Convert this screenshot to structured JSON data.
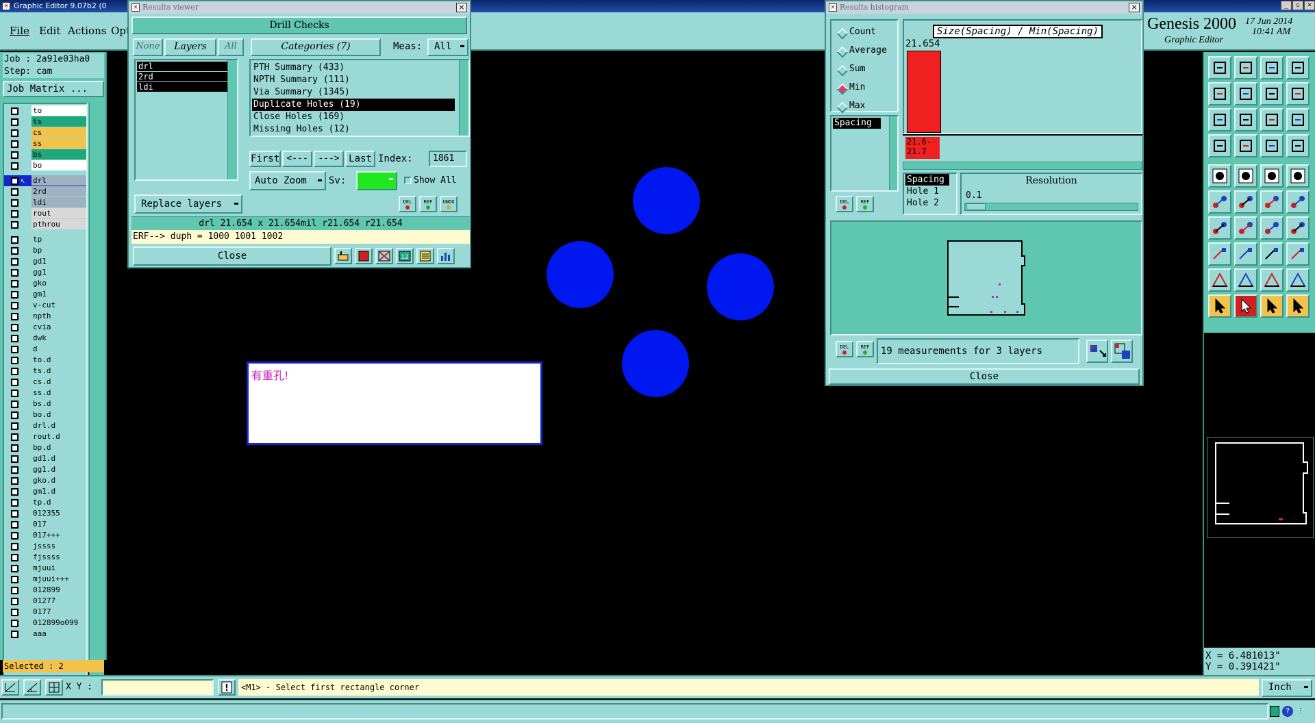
{
  "app": {
    "title": "Graphic Editor 9.07b2 (0",
    "brand": "Genesis 2000",
    "brand_sub": "Graphic Editor",
    "date": "17 Jun 2014",
    "time": "10:41 AM"
  },
  "menu": [
    "File",
    "Edit",
    "Actions",
    "Opt"
  ],
  "job": {
    "job_label": "Job : 2a91e03ha0",
    "step_label": "Step: cam",
    "matrix_button": "Job Matrix ..."
  },
  "layers": [
    {
      "name": "to",
      "color": "#ffffff"
    },
    {
      "name": "ts",
      "color": "#1fa67a"
    },
    {
      "name": "cs",
      "color": "#f3c24a"
    },
    {
      "name": "ss",
      "color": "#f3c24a"
    },
    {
      "name": "bs",
      "color": "#1fa67a"
    },
    {
      "name": "bo",
      "color": "#ffffff"
    },
    {
      "name": "drl",
      "color": "#9fb2c2",
      "active": true
    },
    {
      "name": "2rd",
      "color": "#9fb2c2"
    },
    {
      "name": "ldi",
      "color": "#9fb2c2"
    },
    {
      "name": "rout",
      "color": "#d8d8d8"
    },
    {
      "name": "pthrou",
      "color": "#d8d8d8"
    },
    {
      "name": "tp",
      "color": "#9ad9d6"
    },
    {
      "name": "bp",
      "color": "#9ad9d6"
    },
    {
      "name": "gd1",
      "color": "#9ad9d6"
    },
    {
      "name": "gg1",
      "color": "#9ad9d6"
    },
    {
      "name": "gko",
      "color": "#9ad9d6"
    },
    {
      "name": "gm1",
      "color": "#9ad9d6"
    },
    {
      "name": "v-cut",
      "color": "#9ad9d6"
    },
    {
      "name": "npth",
      "color": "#9ad9d6"
    },
    {
      "name": "cvia",
      "color": "#9ad9d6"
    },
    {
      "name": "dwk",
      "color": "#9ad9d6"
    },
    {
      "name": "d",
      "color": "#9ad9d6"
    },
    {
      "name": "to.d",
      "color": "#9ad9d6"
    },
    {
      "name": "ts.d",
      "color": "#9ad9d6"
    },
    {
      "name": "cs.d",
      "color": "#9ad9d6"
    },
    {
      "name": "ss.d",
      "color": "#9ad9d6"
    },
    {
      "name": "bs.d",
      "color": "#9ad9d6"
    },
    {
      "name": "bo.d",
      "color": "#9ad9d6"
    },
    {
      "name": "drl.d",
      "color": "#9ad9d6"
    },
    {
      "name": "rout.d",
      "color": "#9ad9d6"
    },
    {
      "name": "bp.d",
      "color": "#9ad9d6"
    },
    {
      "name": "gd1.d",
      "color": "#9ad9d6"
    },
    {
      "name": "gg1.d",
      "color": "#9ad9d6"
    },
    {
      "name": "gko.d",
      "color": "#9ad9d6"
    },
    {
      "name": "gm1.d",
      "color": "#9ad9d6"
    },
    {
      "name": "tp.d",
      "color": "#9ad9d6"
    },
    {
      "name": "012355",
      "color": "#9ad9d6"
    },
    {
      "name": "017",
      "color": "#9ad9d6"
    },
    {
      "name": "017+++",
      "color": "#9ad9d6"
    },
    {
      "name": "jssss",
      "color": "#9ad9d6"
    },
    {
      "name": "fjssss",
      "color": "#9ad9d6"
    },
    {
      "name": "mjuui",
      "color": "#9ad9d6"
    },
    {
      "name": "mjuui+++",
      "color": "#9ad9d6"
    },
    {
      "name": "012899",
      "color": "#9ad9d6"
    },
    {
      "name": "01277",
      "color": "#9ad9d6"
    },
    {
      "name": "0177",
      "color": "#9ad9d6"
    },
    {
      "name": "012899o099",
      "color": "#9ad9d6"
    },
    {
      "name": "aaa",
      "color": "#9ad9d6"
    }
  ],
  "selected": "Selected : 2",
  "results_viewer": {
    "title": "Results viewer",
    "header": "Drill Checks",
    "none_btn": "None",
    "layers_btn": "Layers",
    "all_btn": "All",
    "layers_list": [
      "drl",
      "2rd",
      "ldi"
    ],
    "categories_btn": "Categories (7)",
    "meas_label": "Meas:",
    "meas_value": "All",
    "categories": [
      {
        "label": "PTH Summary (433)",
        "selected": false
      },
      {
        "label": "NPTH Summary (111)",
        "selected": false
      },
      {
        "label": "Via Summary (1345)",
        "selected": false
      },
      {
        "label": "Duplicate Holes (19)",
        "selected": true
      },
      {
        "label": "Close Holes (169)",
        "selected": false
      },
      {
        "label": "Missing Holes (12)",
        "selected": false
      }
    ],
    "first": "First",
    "prev": "<---",
    "next": "--->",
    "last": "Last",
    "index_label": "Index:",
    "index_value": "1861",
    "auto_zoom": "Auto Zoom",
    "sv_label": "Sv:",
    "show_all": "Show All",
    "replace_layers": "Replace layers",
    "del": "DEL",
    "ref": "REF",
    "undo": "UNDO",
    "info_line": "drl 21.654 x 21.654mil  r21.654  r21.654",
    "erf_line": "ERF--> duph = 1000 1001 1002",
    "close": "Close"
  },
  "histogram": {
    "title": "Results histogram",
    "radios": [
      {
        "label": "Count",
        "on": false
      },
      {
        "label": "Average",
        "on": false
      },
      {
        "label": "Sum",
        "on": false
      },
      {
        "label": "Min",
        "on": true
      },
      {
        "label": "Max",
        "on": false
      }
    ],
    "chart_title": "Size(Spacing) / Min(Spacing)",
    "bar_value_label": "21.654",
    "bar_range_label": "21.6-\n21.7",
    "bar_level": 1.0,
    "measure_list_left": [
      "Spacing"
    ],
    "measure_list_right": [
      "Spacing",
      "Hole 1",
      "Hole 2"
    ],
    "resolution_label": "Resolution",
    "resolution_value": "0.1",
    "del": "DEL",
    "ref": "REF",
    "summary": "19 measurements for 3 layers",
    "close": "Close"
  },
  "canvas": {
    "message": "有重孔!",
    "hole_color": "#0018f0"
  },
  "coords": {
    "x": "X = 6.481013\"",
    "y": "Y = 0.391421\""
  },
  "bottom": {
    "xy_label": "X Y :",
    "prompt": "<M1> - Select first rectangle corner",
    "unit": "Inch"
  }
}
